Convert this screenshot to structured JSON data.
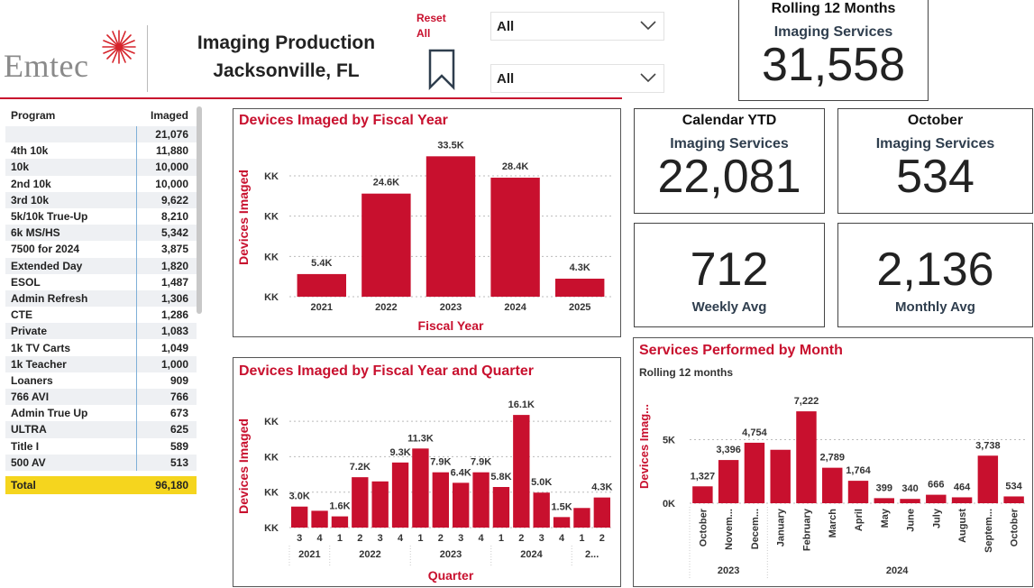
{
  "header": {
    "logo_text": "Emtec",
    "title_line1": "Imaging Production",
    "title_line2": "Jacksonville, FL",
    "reset_label_line1": "Reset",
    "reset_label_line2": "All",
    "bookmark_icon": "bookmark-icon",
    "slicer1_value": "All",
    "slicer2_value": "All",
    "accent_color": "#c8102e"
  },
  "cards": {
    "rolling": {
      "title": "Rolling 12 Months",
      "subtitle": "Imaging Services",
      "value": "31,558"
    },
    "ytd": {
      "title": "Calendar YTD",
      "subtitle": "Imaging Services",
      "value": "22,081"
    },
    "month": {
      "title": "October",
      "subtitle": "Imaging Services",
      "value": "534"
    },
    "weekly": {
      "value": "712",
      "label": "Weekly Avg"
    },
    "monthly": {
      "value": "2,136",
      "label": "Monthly Avg"
    }
  },
  "program_table": {
    "headers": [
      "Program",
      "Imaged"
    ],
    "rows": [
      [
        "",
        "21,076"
      ],
      [
        "4th 10k",
        "11,880"
      ],
      [
        "10k",
        "10,000"
      ],
      [
        "2nd 10k",
        "10,000"
      ],
      [
        "3rd 10k",
        "9,622"
      ],
      [
        "5k/10k True-Up",
        "8,210"
      ],
      [
        "6k MS/HS",
        "5,342"
      ],
      [
        "7500 for 2024",
        "3,875"
      ],
      [
        "Extended Day",
        "1,820"
      ],
      [
        "ESOL",
        "1,487"
      ],
      [
        "Admin Refresh",
        "1,306"
      ],
      [
        "CTE",
        "1,286"
      ],
      [
        "Private",
        "1,083"
      ],
      [
        "1k TV Carts",
        "1,049"
      ],
      [
        "1k Teacher",
        "1,000"
      ],
      [
        "Loaners",
        "909"
      ],
      [
        "766 AVI",
        "766"
      ],
      [
        "Admin True Up",
        "673"
      ],
      [
        "ULTRA",
        "625"
      ],
      [
        "Title I",
        "589"
      ],
      [
        "500 AV",
        "513"
      ]
    ],
    "total_label": "Total",
    "total_value": "96,180"
  },
  "chart_data": [
    {
      "type": "bar",
      "title": "Devices Imaged by Fiscal Year",
      "xlabel": "Fiscal Year",
      "ylabel": "Devices Imaged",
      "ytick_labels": [
        "KK",
        "KK",
        "KK",
        "KK"
      ],
      "categories": [
        "2021",
        "2022",
        "2023",
        "2024",
        "2025"
      ],
      "values": [
        5.4,
        24.6,
        33.5,
        28.4,
        4.3
      ],
      "data_labels": [
        "5.4K",
        "24.6K",
        "33.5K",
        "28.4K",
        "4.3K"
      ],
      "ylim": [
        0,
        34
      ],
      "grid": true
    },
    {
      "type": "bar",
      "title": "Devices Imaged by Fiscal Year and Quarter",
      "xlabel": "Quarter",
      "ylabel": "Devices Imaged",
      "ytick_labels": [
        "KK",
        "KK",
        "KK",
        "KK"
      ],
      "quarters": [
        "3",
        "4",
        "1",
        "2",
        "3",
        "4",
        "1",
        "2",
        "3",
        "4",
        "1",
        "2",
        "3",
        "4",
        "1",
        "2"
      ],
      "year_groups": [
        {
          "label": "2021",
          "count": 2
        },
        {
          "label": "2022",
          "count": 4
        },
        {
          "label": "2023",
          "count": 4
        },
        {
          "label": "2024",
          "count": 4
        },
        {
          "label": "2...",
          "count": 2
        }
      ],
      "values": [
        3.0,
        2.4,
        1.6,
        7.2,
        6.6,
        9.3,
        11.3,
        7.9,
        6.4,
        7.9,
        5.8,
        16.1,
        5.0,
        1.5,
        2.8,
        4.3
      ],
      "data_labels": [
        "3.0K",
        "",
        "1.6K",
        "7.2K",
        "",
        "9.3K",
        "11.3K",
        "7.9K",
        "6.4K",
        "7.9K",
        "5.8K",
        "16.1K",
        "5.0K",
        "1.5K",
        "",
        "4.3K"
      ],
      "ylim": [
        0,
        16.5
      ],
      "grid": true
    },
    {
      "type": "bar",
      "title": "Services Performed by Month",
      "subtitle": "Rolling 12 months",
      "ylabel": "Devices Imag...",
      "ytick_labels": [
        "0K",
        "5K"
      ],
      "yticks": [
        0,
        5000
      ],
      "categories": [
        "October",
        "Novem...",
        "Decem...",
        "January",
        "February",
        "March",
        "April",
        "May",
        "June",
        "July",
        "August",
        "Septem...",
        "October"
      ],
      "year_groups": [
        {
          "label": "2023",
          "count": 3
        },
        {
          "label": "2024",
          "count": 10
        }
      ],
      "values": [
        1327,
        3396,
        4754,
        4200,
        7222,
        2789,
        1764,
        399,
        340,
        666,
        464,
        3738,
        534
      ],
      "data_labels": [
        "1,327",
        "3,396",
        "4,754",
        "",
        "7,222",
        "2,789",
        "1,764",
        "399",
        "340",
        "666",
        "464",
        "3,738",
        "534"
      ],
      "ylim": [
        0,
        7300
      ],
      "grid": true
    }
  ]
}
